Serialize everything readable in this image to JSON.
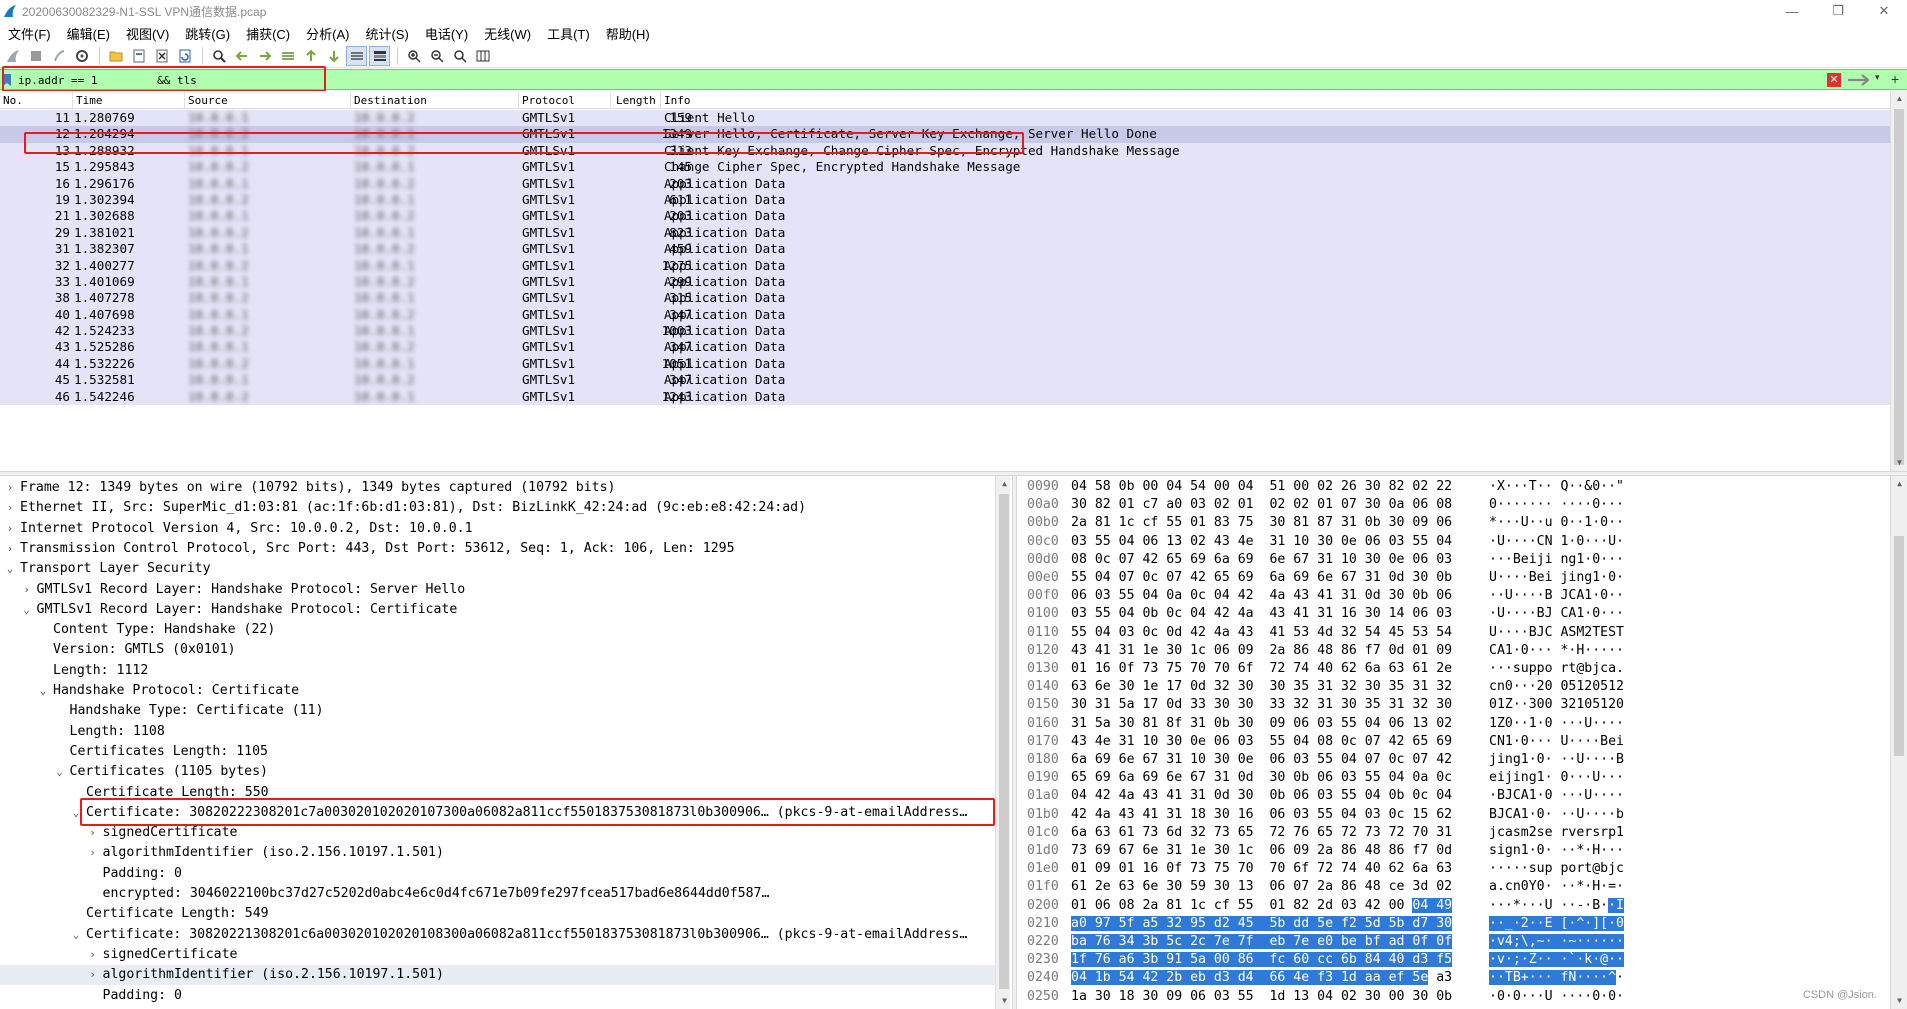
{
  "window": {
    "title": "20200630082329-N1-SSL VPN通信数据.pcap",
    "minimize": "—",
    "restore": "❐",
    "close": "✕"
  },
  "menu": [
    "文件(F)",
    "编辑(E)",
    "视图(V)",
    "跳转(G)",
    "捕获(C)",
    "分析(A)",
    "统计(S)",
    "电话(Y)",
    "无线(W)",
    "工具(T)",
    "帮助(H)"
  ],
  "filter": {
    "value": "ip.addr == 10.0.0.1 && tls",
    "display": "ip.addr == 1         && tls",
    "clear": "✕",
    "dropdown": "▾",
    "add": "+"
  },
  "packet_list": {
    "columns": [
      "No.",
      "Time",
      "Source",
      "Destination",
      "Protocol",
      "Length",
      "Info"
    ],
    "rows": [
      {
        "no": "11",
        "time": "1.280769",
        "src": "10.0.0.1",
        "dst": "10.0.0.2",
        "proto": "GMTLSv1",
        "len": "159",
        "info": "Client Hello"
      },
      {
        "no": "12",
        "time": "1.284294",
        "src": "10.0.0.2",
        "dst": "10.0.0.1",
        "proto": "GMTLSv1",
        "len": "1349",
        "info": "Server Hello, Certificate, Server Key Exchange, Server Hello Done",
        "selected": true
      },
      {
        "no": "13",
        "time": "1.288932",
        "src": "10.0.0.1",
        "dst": "10.0.0.2",
        "proto": "GMTLSv1",
        "len": "313",
        "info": "Client Key Exchange, Change Cipher Spec, Encrypted Handshake Message"
      },
      {
        "no": "15",
        "time": "1.295843",
        "src": "10.0.0.2",
        "dst": "10.0.0.1",
        "proto": "GMTLSv1",
        "len": "145",
        "info": "Change Cipher Spec, Encrypted Handshake Message"
      },
      {
        "no": "16",
        "time": "1.296176",
        "src": "10.0.0.1",
        "dst": "10.0.0.2",
        "proto": "GMTLSv1",
        "len": "203",
        "info": "Application Data"
      },
      {
        "no": "19",
        "time": "1.302394",
        "src": "10.0.0.2",
        "dst": "10.0.0.1",
        "proto": "GMTLSv1",
        "len": "611",
        "info": "Application Data"
      },
      {
        "no": "21",
        "time": "1.302688",
        "src": "10.0.0.1",
        "dst": "10.0.0.2",
        "proto": "GMTLSv1",
        "len": "203",
        "info": "Application Data"
      },
      {
        "no": "29",
        "time": "1.381021",
        "src": "10.0.0.2",
        "dst": "10.0.0.1",
        "proto": "GMTLSv1",
        "len": "823",
        "info": "Application Data"
      },
      {
        "no": "31",
        "time": "1.382307",
        "src": "10.0.0.1",
        "dst": "10.0.0.2",
        "proto": "GMTLSv1",
        "len": "459",
        "info": "Application Data"
      },
      {
        "no": "32",
        "time": "1.400277",
        "src": "10.0.0.2",
        "dst": "10.0.0.1",
        "proto": "GMTLSv1",
        "len": "1275",
        "info": "Application Data"
      },
      {
        "no": "33",
        "time": "1.401069",
        "src": "10.0.0.1",
        "dst": "10.0.0.2",
        "proto": "GMTLSv1",
        "len": "299",
        "info": "Application Data"
      },
      {
        "no": "38",
        "time": "1.407278",
        "src": "10.0.0.2",
        "dst": "10.0.0.1",
        "proto": "GMTLSv1",
        "len": "315",
        "info": "Application Data"
      },
      {
        "no": "40",
        "time": "1.407698",
        "src": "10.0.0.1",
        "dst": "10.0.0.2",
        "proto": "GMTLSv1",
        "len": "347",
        "info": "Application Data"
      },
      {
        "no": "42",
        "time": "1.524233",
        "src": "10.0.0.2",
        "dst": "10.0.0.1",
        "proto": "GMTLSv1",
        "len": "1003",
        "info": "Application Data"
      },
      {
        "no": "43",
        "time": "1.525286",
        "src": "10.0.0.1",
        "dst": "10.0.0.2",
        "proto": "GMTLSv1",
        "len": "347",
        "info": "Application Data"
      },
      {
        "no": "44",
        "time": "1.532226",
        "src": "10.0.0.2",
        "dst": "10.0.0.1",
        "proto": "GMTLSv1",
        "len": "1051",
        "info": "Application Data"
      },
      {
        "no": "45",
        "time": "1.532581",
        "src": "10.0.0.1",
        "dst": "10.0.0.2",
        "proto": "GMTLSv1",
        "len": "347",
        "info": "Application Data"
      },
      {
        "no": "46",
        "time": "1.542246",
        "src": "10.0.0.2",
        "dst": "10.0.0.1",
        "proto": "GMTLSv1",
        "len": "1243",
        "info": "Application Data"
      }
    ]
  },
  "details": [
    {
      "indent": 0,
      "arrow": ">",
      "text": "Frame 12: 1349 bytes on wire (10792 bits), 1349 bytes captured (10792 bits)"
    },
    {
      "indent": 0,
      "arrow": ">",
      "text": "Ethernet II, Src: SuperMic_d1:03:81 (ac:1f:6b:d1:03:81), Dst: BizLinkK_42:24:ad (9c:eb:e8:42:24:ad)"
    },
    {
      "indent": 0,
      "arrow": ">",
      "text": "Internet Protocol Version 4, Src: 10.0.0.2, Dst: 10.0.0.1"
    },
    {
      "indent": 0,
      "arrow": ">",
      "text": "Transmission Control Protocol, Src Port: 443, Dst Port: 53612, Seq: 1, Ack: 106, Len: 1295"
    },
    {
      "indent": 0,
      "arrow": "v",
      "text": "Transport Layer Security"
    },
    {
      "indent": 1,
      "arrow": ">",
      "text": "GMTLSv1 Record Layer: Handshake Protocol: Server Hello"
    },
    {
      "indent": 1,
      "arrow": "v",
      "text": "GMTLSv1 Record Layer: Handshake Protocol: Certificate"
    },
    {
      "indent": 2,
      "arrow": "",
      "text": "Content Type: Handshake (22)"
    },
    {
      "indent": 2,
      "arrow": "",
      "text": "Version: GMTLS (0x0101)"
    },
    {
      "indent": 2,
      "arrow": "",
      "text": "Length: 1112"
    },
    {
      "indent": 2,
      "arrow": "v",
      "text": "Handshake Protocol: Certificate"
    },
    {
      "indent": 3,
      "arrow": "",
      "text": "Handshake Type: Certificate (11)"
    },
    {
      "indent": 3,
      "arrow": "",
      "text": "Length: 1108"
    },
    {
      "indent": 3,
      "arrow": "",
      "text": "Certificates Length: 1105"
    },
    {
      "indent": 3,
      "arrow": "v",
      "text": "Certificates (1105 bytes)"
    },
    {
      "indent": 4,
      "arrow": "",
      "text": "Certificate Length: 550"
    },
    {
      "indent": 4,
      "arrow": "v",
      "text": "Certificate: 30820222308201c7a003020102020107300a06082a811ccf550183753081873l0b300906… (pkcs-9-at-emailAddress…"
    },
    {
      "indent": 5,
      "arrow": ">",
      "text": "signedCertificate"
    },
    {
      "indent": 5,
      "arrow": ">",
      "text": "algorithmIdentifier (iso.2.156.10197.1.501)"
    },
    {
      "indent": 5,
      "arrow": "",
      "text": "Padding: 0"
    },
    {
      "indent": 5,
      "arrow": "",
      "text": "encrypted: 3046022100bc37d27c5202d0abc4e6c0d4fc671e7b09fe297fcea517bad6e8644dd0f587…"
    },
    {
      "indent": 4,
      "arrow": "",
      "text": "Certificate Length: 549"
    },
    {
      "indent": 4,
      "arrow": "v",
      "text": "Certificate: 30820221308201c6a003020102020108300a06082a811ccf550183753081873l0b300906… (pkcs-9-at-emailAddress…"
    },
    {
      "indent": 5,
      "arrow": ">",
      "text": "signedCertificate"
    },
    {
      "indent": 5,
      "arrow": ">",
      "text": "algorithmIdentifier (iso.2.156.10197.1.501)",
      "sel": true
    },
    {
      "indent": 5,
      "arrow": "",
      "text": "Padding: 0"
    }
  ],
  "hex": [
    {
      "off": "0090",
      "bytes": "04 58 0b 00 04 54 00 04  51 00 02 26 30 82 02 22",
      "ascii": "·X···T·· Q··&0··\""
    },
    {
      "off": "00a0",
      "bytes": "30 82 01 c7 a0 03 02 01  02 02 01 07 30 0a 06 08",
      "ascii": "0······· ····0···"
    },
    {
      "off": "00b0",
      "bytes": "2a 81 1c cf 55 01 83 75  30 81 87 31 0b 30 09 06",
      "ascii": "*···U··u 0··1·0··"
    },
    {
      "off": "00c0",
      "bytes": "03 55 04 06 13 02 43 4e  31 10 30 0e 06 03 55 04",
      "ascii": "·U····CN 1·0···U·"
    },
    {
      "off": "00d0",
      "bytes": "08 0c 07 42 65 69 6a 69  6e 67 31 10 30 0e 06 03",
      "ascii": "···Beiji ng1·0···"
    },
    {
      "off": "00e0",
      "bytes": "55 04 07 0c 07 42 65 69  6a 69 6e 67 31 0d 30 0b",
      "ascii": "U····Bei jing1·0·"
    },
    {
      "off": "00f0",
      "bytes": "06 03 55 04 0a 0c 04 42  4a 43 41 31 0d 30 0b 06",
      "ascii": "··U····B JCA1·0··"
    },
    {
      "off": "0100",
      "bytes": "03 55 04 0b 0c 04 42 4a  43 41 31 16 30 14 06 03",
      "ascii": "·U····BJ CA1·0···"
    },
    {
      "off": "0110",
      "bytes": "55 04 03 0c 0d 42 4a 43  41 53 4d 32 54 45 53 54",
      "ascii": "U····BJC ASM2TEST"
    },
    {
      "off": "0120",
      "bytes": "43 41 31 1e 30 1c 06 09  2a 86 48 86 f7 0d 01 09",
      "ascii": "CA1·0··· *·H·····"
    },
    {
      "off": "0130",
      "bytes": "01 16 0f 73 75 70 70 6f  72 74 40 62 6a 63 61 2e",
      "ascii": "···suppo rt@bjca."
    },
    {
      "off": "0140",
      "bytes": "63 6e 30 1e 17 0d 32 30  30 35 31 32 30 35 31 32",
      "ascii": "cn0···20 05120512"
    },
    {
      "off": "0150",
      "bytes": "30 31 5a 17 0d 33 30 30  33 32 31 30 35 31 32 30",
      "ascii": "01Z··300 32105120"
    },
    {
      "off": "0160",
      "bytes": "31 5a 30 81 8f 31 0b 30  09 06 03 55 04 06 13 02",
      "ascii": "1Z0··1·0 ···U····"
    },
    {
      "off": "0170",
      "bytes": "43 4e 31 10 30 0e 06 03  55 04 08 0c 07 42 65 69",
      "ascii": "CN1·0··· U····Bei"
    },
    {
      "off": "0180",
      "bytes": "6a 69 6e 67 31 10 30 0e  06 03 55 04 07 0c 07 42",
      "ascii": "jing1·0· ··U····B"
    },
    {
      "off": "0190",
      "bytes": "65 69 6a 69 6e 67 31 0d  30 0b 06 03 55 04 0a 0c",
      "ascii": "eijing1· 0···U···"
    },
    {
      "off": "01a0",
      "bytes": "04 42 4a 43 41 31 0d 30  0b 06 03 55 04 0b 0c 04",
      "ascii": "·BJCA1·0 ···U····"
    },
    {
      "off": "01b0",
      "bytes": "42 4a 43 41 31 18 30 16  06 03 55 04 03 0c 15 62",
      "ascii": "BJCA1·0· ··U····b"
    },
    {
      "off": "01c0",
      "bytes": "6a 63 61 73 6d 32 73 65  72 76 65 72 73 72 70 31",
      "ascii": "jcasm2se rversrp1"
    },
    {
      "off": "01d0",
      "bytes": "73 69 67 6e 31 1e 30 1c  06 09 2a 86 48 86 f7 0d",
      "ascii": "sign1·0· ··*·H···"
    },
    {
      "off": "01e0",
      "bytes": "01 09 01 16 0f 73 75 70  70 6f 72 74 40 62 6a 63",
      "ascii": "·····sup port@bjc"
    },
    {
      "off": "01f0",
      "bytes": "61 2e 63 6e 30 59 30 13  06 07 2a 86 48 ce 3d 02",
      "ascii": "a.cn0Y0· ··*·H·=·"
    },
    {
      "off": "0200",
      "bytes": "01 06 08 2a 81 1c cf 55  01 82 2d 03 42 00 ",
      "sel": "04 49",
      "ascii": "···*···U ··-·B·",
      "asel": "·I"
    },
    {
      "off": "0210",
      "bytes": "",
      "sel": "a0 97 5f a5 32 95 d2 45  5b dd 5e f2 5d 5b d7 30",
      "ascii": "",
      "asel": "··_·2··E [·^·][·0"
    },
    {
      "off": "0220",
      "bytes": "",
      "sel": "ba 76 34 3b 5c 2c 7e 7f  eb 7e e0 be bf ad 0f 0f",
      "ascii": "",
      "asel": "·v4;\\,~· ·~······"
    },
    {
      "off": "0230",
      "bytes": "",
      "sel": "1f 76 a6 3b 91 5a 00 86  fc 60 cc 6b 84 40 d3 f5",
      "ascii": "",
      "asel": "·v·;·Z·· ·`·k·@··"
    },
    {
      "off": "0240",
      "bytes": "",
      "sel": "04 1b 54 42 2b eb d3 d4  66 4e f3 1d aa ef 5e",
      "tail": " a3",
      "ascii": "",
      "asel": "··TB+··· fN····^",
      "atail": "·"
    },
    {
      "off": "0250",
      "bytes": "1a 30 18 30 09 06 03 55  1d 13 04 02 30 00 30 0b",
      "ascii": "·0·0···U ····0·0·"
    }
  ],
  "watermark": "CSDN @Jsion."
}
